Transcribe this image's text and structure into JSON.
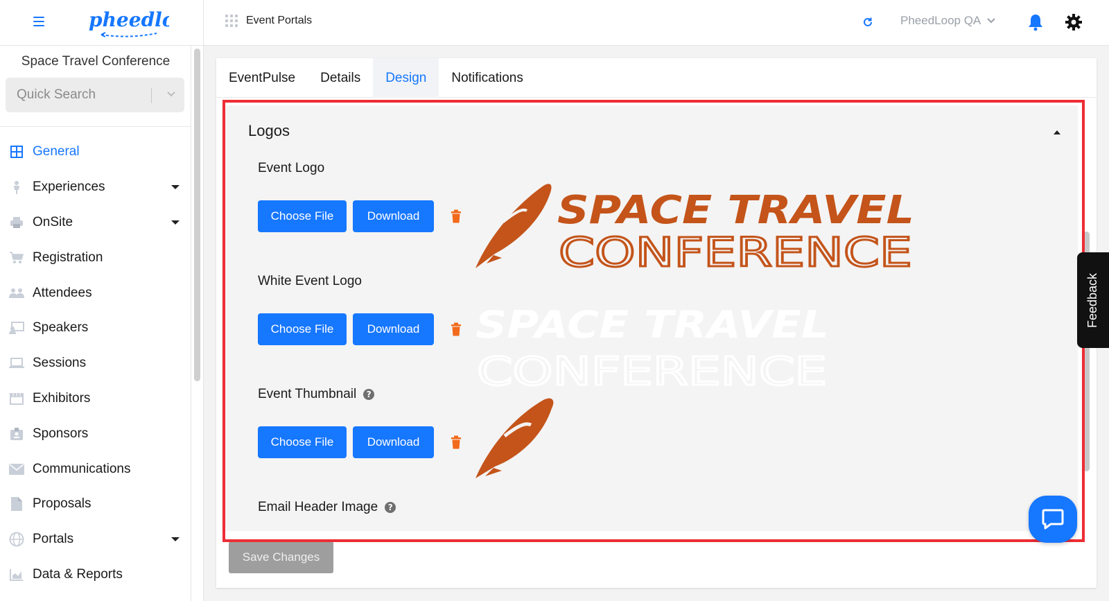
{
  "header": {
    "brand": "pheedloop",
    "breadcrumb": "Event Portals",
    "org_name": "PheedLoop QA"
  },
  "sidebar": {
    "event_name": "Space Travel Conference",
    "search_placeholder": "Quick Search",
    "items": [
      {
        "label": "General",
        "icon": "grid-icon",
        "active": true,
        "has_caret": false
      },
      {
        "label": "Experiences",
        "icon": "person-icon",
        "has_caret": true
      },
      {
        "label": "OnSite",
        "icon": "printer-icon",
        "has_caret": true
      },
      {
        "label": "Registration",
        "icon": "cart-icon",
        "has_caret": false
      },
      {
        "label": "Attendees",
        "icon": "people-icon",
        "has_caret": false
      },
      {
        "label": "Speakers",
        "icon": "presenter-icon",
        "has_caret": false
      },
      {
        "label": "Sessions",
        "icon": "laptop-icon",
        "has_caret": false
      },
      {
        "label": "Exhibitors",
        "icon": "store-icon",
        "has_caret": false
      },
      {
        "label": "Sponsors",
        "icon": "badge-icon",
        "has_caret": false
      },
      {
        "label": "Communications",
        "icon": "mail-icon",
        "has_caret": false
      },
      {
        "label": "Proposals",
        "icon": "file-icon",
        "has_caret": false
      },
      {
        "label": "Portals",
        "icon": "globe-icon",
        "has_caret": true
      },
      {
        "label": "Data & Reports",
        "icon": "chart-icon",
        "has_caret": false
      }
    ]
  },
  "tabs": [
    {
      "label": "EventPulse",
      "active": false
    },
    {
      "label": "Details",
      "active": false
    },
    {
      "label": "Design",
      "active": true
    },
    {
      "label": "Notifications",
      "active": false
    }
  ],
  "logos_section": {
    "title": "Logos",
    "choose_label": "Choose File",
    "download_label": "Download",
    "fields": [
      {
        "label": "Event Logo",
        "has_help": false
      },
      {
        "label": "White Event Logo",
        "has_help": false
      },
      {
        "label": "Event Thumbnail",
        "has_help": true
      },
      {
        "label": "Email Header Image",
        "has_help": true
      }
    ],
    "logo_text_line1": "SPACE TRAVEL",
    "logo_text_line2": "CONFERENCE"
  },
  "save_label": "Save Changes",
  "feedback_label": "Feedback",
  "colors": {
    "accent": "#1677ff",
    "logo_orange": "#c4541a",
    "highlight": "#ee2d35",
    "trash": "#f26a1b"
  }
}
